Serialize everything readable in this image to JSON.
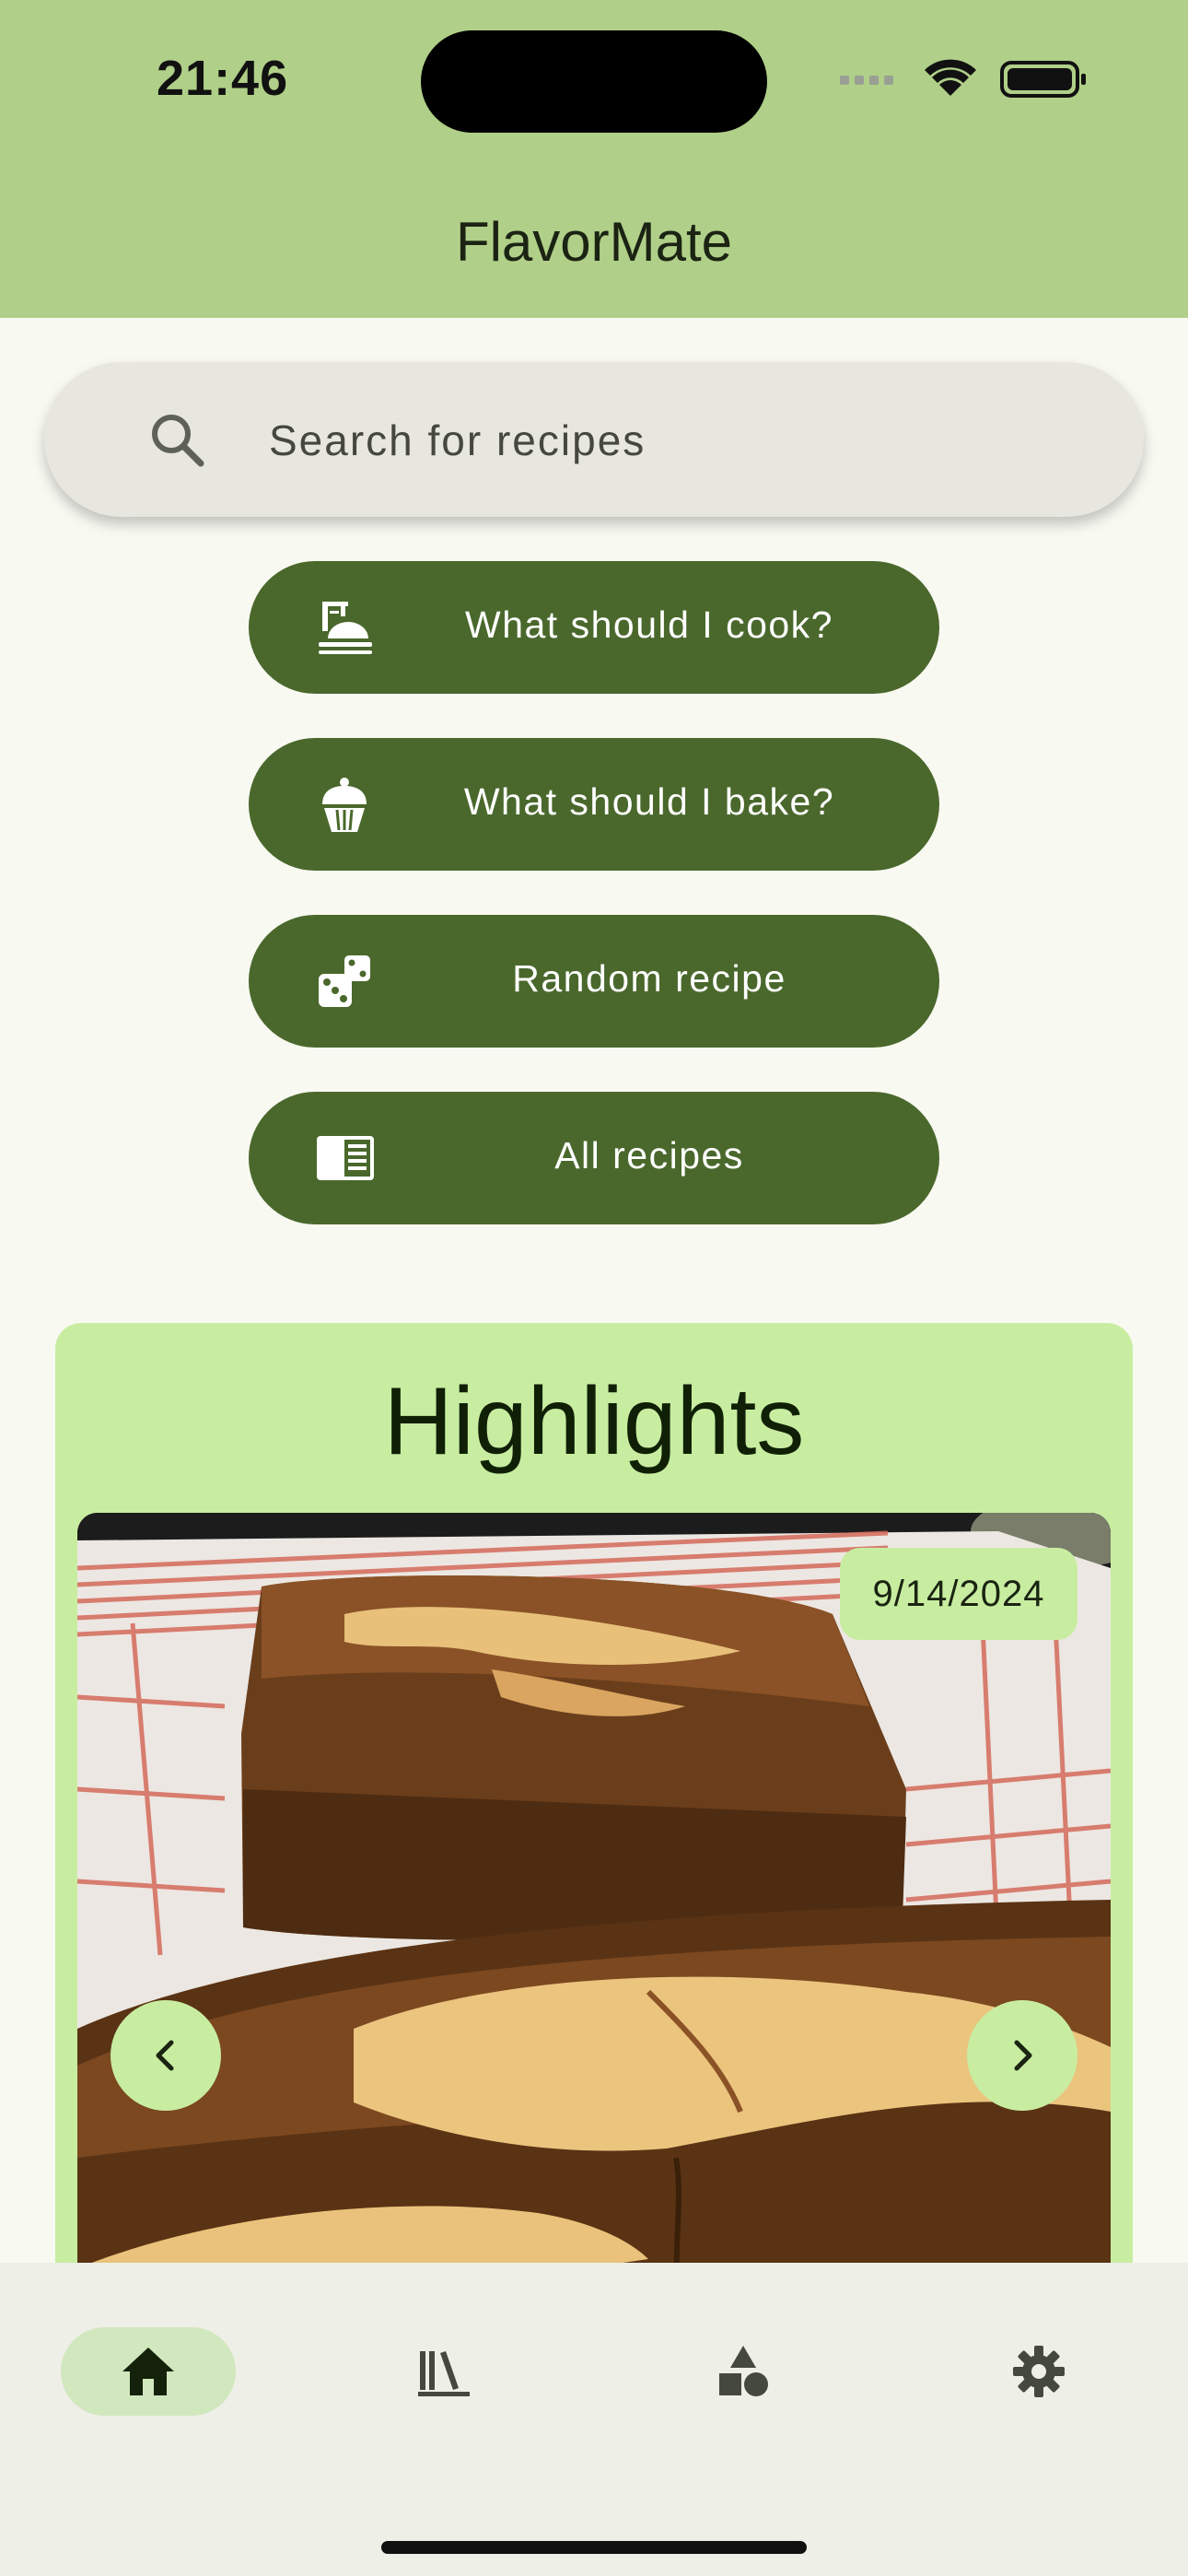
{
  "status_bar": {
    "time": "21:46"
  },
  "app_bar": {
    "title": "FlavorMate"
  },
  "search": {
    "placeholder": "Search for recipes",
    "icon": "search-icon"
  },
  "actions": [
    {
      "label": "What should I cook?",
      "icon": "cooking-pot-icon"
    },
    {
      "label": "What should I bake?",
      "icon": "cupcake-icon"
    },
    {
      "label": "Random recipe",
      "icon": "dice-icon"
    },
    {
      "label": "All recipes",
      "icon": "book-list-icon"
    }
  ],
  "highlights": {
    "title": "Highlights",
    "date": "9/14/2024",
    "image": "loaf-cake-photo"
  },
  "bottom_nav": [
    {
      "icon": "home-icon",
      "active": true
    },
    {
      "icon": "library-icon",
      "active": false
    },
    {
      "icon": "shapes-icon",
      "active": false
    },
    {
      "icon": "settings-icon",
      "active": false
    }
  ],
  "colors": {
    "app_bar": "#b0cf88",
    "background": "#f8f9f1",
    "button": "#4a682c",
    "card": "#c8eda1",
    "nav_active_pill": "#d1e7bd"
  }
}
